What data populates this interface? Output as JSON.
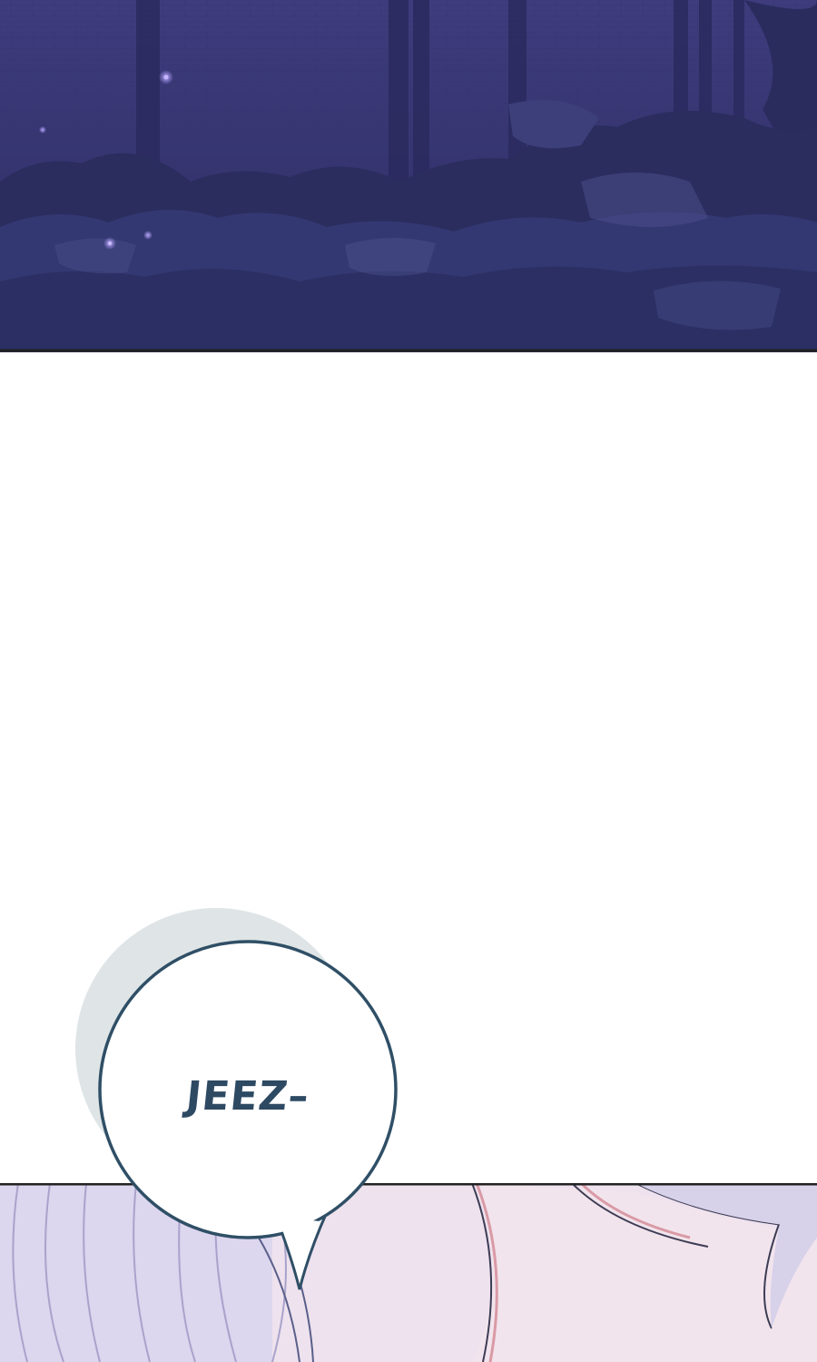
{
  "speech_bubble": {
    "text": "JEEZ–"
  },
  "colors": {
    "night_sky": "#3b3a78",
    "rock_shadow": "#262a55",
    "rock_light": "#4a4d8a",
    "bubble_outline": "#2f4f66",
    "bubble_shadow": "#dfe5e6",
    "hair_lavender": "#d7d1ea",
    "skin_pink": "#f0dfe9",
    "line_red": "#d99aa6"
  },
  "icons": [
    "firefly-glow",
    "speech-bubble",
    "hair-strands"
  ]
}
